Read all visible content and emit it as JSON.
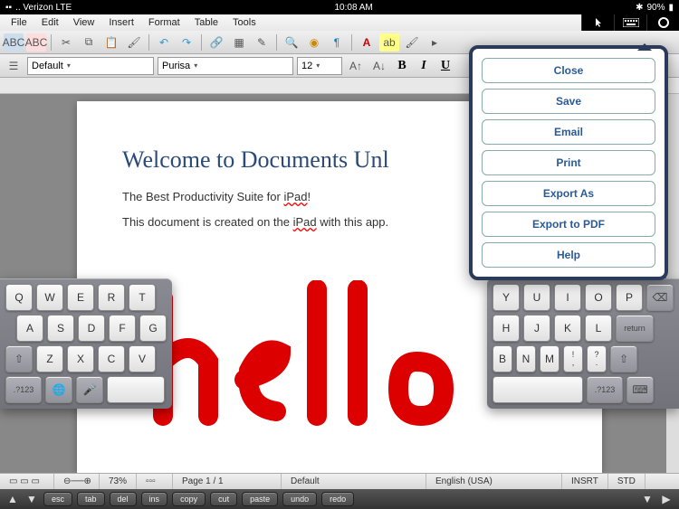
{
  "status_bar": {
    "carrier": ".. Verizon  LTE",
    "time": "10:08 AM",
    "bt": "✱",
    "battery": "90%",
    "bat_icon": "▮"
  },
  "menu": {
    "items": [
      "File",
      "Edit",
      "View",
      "Insert",
      "Format",
      "Table",
      "Tools"
    ]
  },
  "toolbar2": {
    "style": "Default",
    "font": "Purisa",
    "size": "12",
    "bold": "B",
    "italic": "I",
    "underline": "U"
  },
  "document": {
    "title": "Welcome to Documents Unl",
    "line1_a": "The Best Productivity Suite for ",
    "line1_b": "iPad",
    "line1_c": "!",
    "line2_a": "This document is created on the ",
    "line2_b": "iPad",
    "line2_c": " with this app."
  },
  "status_footer": {
    "zoom": "73%",
    "page": "Page 1 / 1",
    "style": "Default",
    "lang": "English (USA)",
    "insrt": "INSRT",
    "std": "STD"
  },
  "cmd_bar": {
    "buttons": [
      "esc",
      "tab",
      "del",
      "ins",
      "copy",
      "cut",
      "paste",
      "undo",
      "redo"
    ]
  },
  "popover": {
    "items": [
      "Close",
      "Save",
      "Email",
      "Print",
      "Export As",
      "Export to PDF",
      "Help"
    ]
  },
  "kb_left": {
    "r1": [
      "Q",
      "W",
      "E",
      "R",
      "T"
    ],
    "r2": [
      "A",
      "S",
      "D",
      "F",
      "G"
    ],
    "r3": [
      "Z",
      "X",
      "C",
      "V"
    ],
    "shift": "⇧",
    "num": ".?123",
    "globe": "🌐",
    "mic": "🎤"
  },
  "kb_right": {
    "r1": [
      "Y",
      "U",
      "I",
      "O",
      "P"
    ],
    "bksp": "⌫",
    "r2": [
      "H",
      "J",
      "K",
      "L"
    ],
    "return": "return",
    "r3": [
      "B",
      "N",
      "M",
      "!",
      ",",
      "?",
      "."
    ],
    "shift": "⇧",
    "num": ".?123",
    "kbd": "⌨"
  }
}
